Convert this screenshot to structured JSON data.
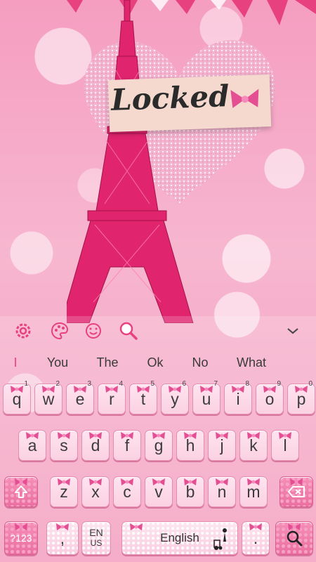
{
  "wallpaper": {
    "plate_text": "Locked"
  },
  "toolbar": {
    "icons": [
      "gear-icon",
      "palette-icon",
      "emoji-icon",
      "search-icon",
      "chevron-down-icon"
    ]
  },
  "suggestions": {
    "cursor": "I",
    "words": [
      "You",
      "The",
      "Ok",
      "No",
      "What"
    ]
  },
  "rows": {
    "row1": [
      "q",
      "w",
      "e",
      "r",
      "t",
      "y",
      "u",
      "i",
      "o",
      "p"
    ],
    "row1_nums": [
      "1",
      "2",
      "3",
      "4",
      "5",
      "6",
      "7",
      "8",
      "9",
      "0"
    ],
    "row2": [
      "a",
      "s",
      "d",
      "f",
      "g",
      "h",
      "j",
      "k",
      "l"
    ],
    "row3": [
      "z",
      "x",
      "c",
      "v",
      "b",
      "n",
      "m"
    ]
  },
  "bottom": {
    "symbols": "?123",
    "comma": ",",
    "lang_code_top": "EN",
    "lang_code_bottom": "US",
    "space": "English",
    "period": "."
  },
  "colors": {
    "accent": "#e8417f",
    "key_border": "#e58db0",
    "text": "#3b3b3b"
  }
}
